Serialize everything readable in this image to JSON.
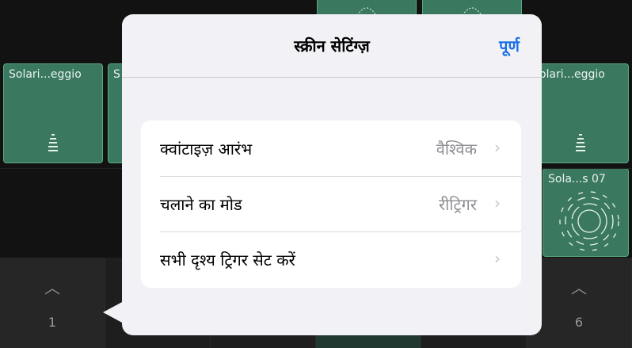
{
  "background": {
    "cells": [
      {
        "label": "Solari...eggio",
        "icon": "spring-wave-icon"
      },
      {
        "label": "S",
        "icon": ""
      },
      {
        "label": "olari...eggio",
        "icon": "spring-wave-icon"
      },
      {
        "label": "Sola...s 07",
        "icon": "circular-wave-icon"
      }
    ],
    "columns": [
      {
        "chevron": "︿",
        "number": "1"
      },
      {
        "chevron": "︿",
        "number": "6"
      }
    ]
  },
  "popover": {
    "title": "स्क्रीन सेटिंग्ज़",
    "done_label": "पूर्ण",
    "rows": [
      {
        "label": "क्वांटाइज़ आरंभ",
        "value": "वैश्विक",
        "chevron": "›"
      },
      {
        "label": "चलाने का मोड",
        "value": "रीट्रिगर",
        "chevron": "›"
      },
      {
        "label": "सभी दृश्य ट्रिगर सेट करें",
        "value": "",
        "chevron": "›"
      }
    ]
  },
  "colors": {
    "accent": "#1a6fe6",
    "cell_green": "#3b7860",
    "popover_bg": "#f2f2f6"
  }
}
